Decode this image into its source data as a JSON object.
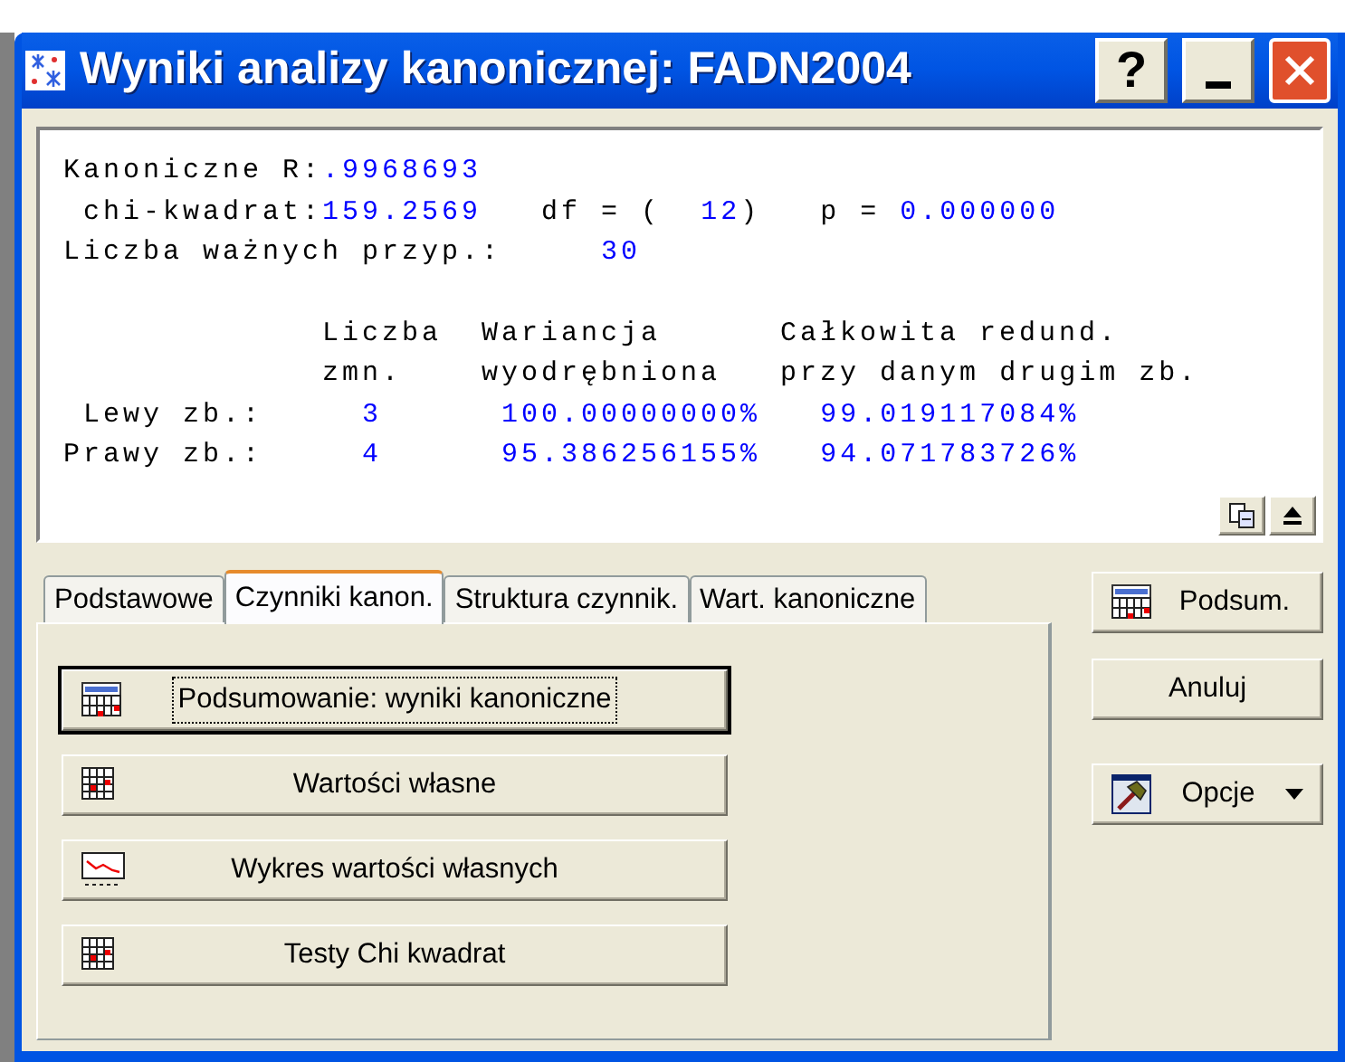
{
  "window": {
    "title": "Wyniki analizy kanonicznej: FADN2004",
    "help": "?"
  },
  "results": {
    "r_label": "Kanoniczne R:",
    "r_value": ".9968693",
    "chi_label": "chi-kwadrat:",
    "chi_value": "159.2569",
    "df_label": "df = (",
    "df_value": "12",
    "df_close": ")",
    "p_label": "p =",
    "p_value": "0.000000",
    "n_label": "Liczba ważnych przyp.:",
    "n_value": "30"
  },
  "table": {
    "headers": [
      [
        "Liczba",
        "zmn."
      ],
      [
        "Wariancja",
        "wyodrębniona"
      ],
      [
        "Całkowita redund.",
        "przy danym drugim zb."
      ]
    ],
    "rows": [
      {
        "label": "Lewy zb.:",
        "values": [
          "3",
          "100.00000000%",
          "99.019117084%"
        ]
      },
      {
        "label": "Prawy zb.:",
        "values": [
          "4",
          "95.386256155%",
          "94.071783726%"
        ]
      }
    ]
  },
  "tabs": [
    {
      "label": "Podstawowe",
      "selected": false
    },
    {
      "label": "Czynniki kanon.",
      "selected": true
    },
    {
      "label": "Struktura czynnik.",
      "selected": false
    },
    {
      "label": "Wart. kanoniczne",
      "selected": false
    }
  ],
  "actions": [
    {
      "label": "Podsumowanie: wyniki kanoniczne",
      "kind": "summary",
      "focused": true
    },
    {
      "label": "Wartości własne",
      "kind": "grid",
      "focused": false
    },
    {
      "label": "Wykres wartości własnych",
      "kind": "plot",
      "focused": false
    },
    {
      "label": "Testy Chi kwadrat",
      "kind": "grid",
      "focused": false
    }
  ],
  "side_buttons": [
    {
      "label": "Podsum.",
      "kind": "summary"
    },
    {
      "label": "Anuluj",
      "kind": "plain"
    },
    {
      "label": "Opcje",
      "kind": "menu"
    }
  ]
}
